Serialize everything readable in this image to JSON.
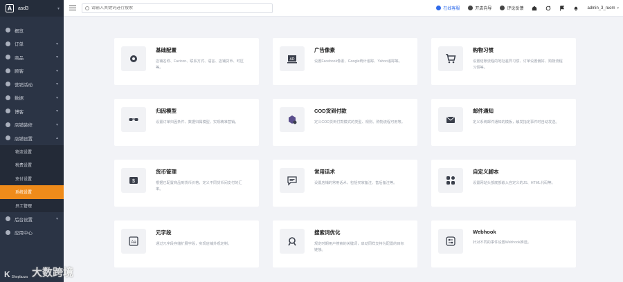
{
  "brand": {
    "logo": "A",
    "name": "asd3",
    "dropdown": "▾"
  },
  "sidebar": {
    "items": [
      {
        "label": "概览",
        "arrow": ""
      },
      {
        "label": "订单",
        "arrow": "▾"
      },
      {
        "label": "商品",
        "arrow": "▾"
      },
      {
        "label": "顾客",
        "arrow": "▾"
      },
      {
        "label": "营销活动",
        "arrow": "▾"
      },
      {
        "label": "数据",
        "arrow": "▾"
      },
      {
        "label": "博客",
        "arrow": "▾"
      },
      {
        "label": "店铺装修",
        "arrow": "▾"
      },
      {
        "label": "店铺设置",
        "arrow": "▴"
      },
      {
        "label": "物流设置",
        "arrow": "",
        "sub": true
      },
      {
        "label": "税费设置",
        "arrow": "",
        "sub": true
      },
      {
        "label": "支付设置",
        "arrow": "",
        "sub": true
      },
      {
        "label": "系统设置",
        "arrow": "",
        "sub": true,
        "active": true
      },
      {
        "label": "员工管理",
        "arrow": "",
        "sub": true
      },
      {
        "label": "后台设置",
        "arrow": "▾"
      },
      {
        "label": "应用中心",
        "arrow": ""
      }
    ]
  },
  "topbar": {
    "search_placeholder": "请输入关键词进行搜索",
    "online_service": "在线客服",
    "guide": "开店向导",
    "feedback": "评论反馈",
    "user": "admin_3_ruom",
    "user_caret": "▾"
  },
  "cards": [
    {
      "title": "基础配置",
      "desc": "店铺名称、Favicon、联系方式、语言、店铺货币、时区等。",
      "icon": "gear-icon"
    },
    {
      "title": "广告像素",
      "desc": "设置Facebook像素、Google统计追踪、Yahoo追踪等。",
      "icon": "ad-icon"
    },
    {
      "title": "购物习惯",
      "desc": "设置结账流程的地址差异习惯、订单设置偏好、购物流程习惯等。",
      "icon": "cart-icon"
    },
    {
      "title": "归因模型",
      "desc": "设置订单归因条件、数据归属模型、实现精准营销。",
      "icon": "glasses-icon"
    },
    {
      "title": "COD货到付款",
      "desc": "定义COD货到付款模式的类型、规则、购物流程可用等。",
      "icon": "cod-icon"
    },
    {
      "title": "邮件通知",
      "desc": "定义系统邮件通知的模板，触发指定事件时自动发送。",
      "icon": "mail-icon"
    },
    {
      "title": "货币管理",
      "desc": "根据已配置商品到货币价格，定义不同货币间支付的汇率。",
      "icon": "currency-icon"
    },
    {
      "title": "常用话术",
      "desc": "设置店铺的常用话术，包括买家备注、售后备注等。",
      "icon": "message-icon"
    },
    {
      "title": "自定义脚本",
      "desc": "设置网站头部底部嵌入自定义的JS、HTML代码等。",
      "icon": "apps-icon"
    },
    {
      "title": "元字段",
      "desc": "通过元字段存储扩展字段，实现店铺外观定制。",
      "icon": "metafield-icon"
    },
    {
      "title": "搜索词优化",
      "desc": "规定时期用户搜索的关键词，启动同样支持为配置的目标链接。",
      "icon": "search-opt-icon"
    },
    {
      "title": "Webhook",
      "desc": "针对不同的事件设置Webhook推送。",
      "icon": "webhook-icon"
    }
  ],
  "watermark": {
    "logo": "K",
    "sub": "Shoplazza",
    "main": "大数跨境"
  },
  "colors": {
    "sidebar_bg": "#2b3445",
    "active": "#ef8b1a",
    "accent": "#2f6bea"
  }
}
